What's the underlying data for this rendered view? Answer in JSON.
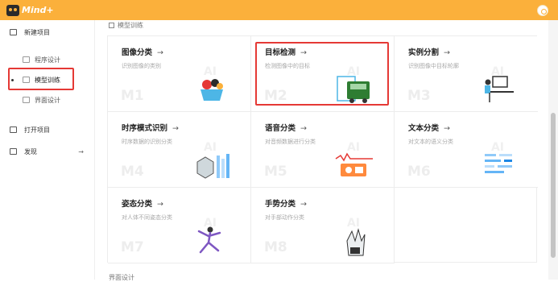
{
  "app": {
    "logo_text": "Mind+"
  },
  "sidebar": {
    "new_project": "新建项目",
    "program_design": "程序设计",
    "model_training": "模型训练",
    "ui_design": "界面设计",
    "open_project": "打开项目",
    "discover": "发现"
  },
  "main": {
    "section_title": "模型训练",
    "next_section": "界面设计",
    "cards": [
      {
        "title": "图像分类",
        "arrow": "→",
        "desc": "识别图像的类别",
        "code": "M1",
        "ai": "AI"
      },
      {
        "title": "目标检测",
        "arrow": "→",
        "desc": "检测图像中的目标",
        "code": "M2",
        "ai": "AI"
      },
      {
        "title": "实例分割",
        "arrow": "→",
        "desc": "识别图像中目标轮廓",
        "code": "M3",
        "ai": "AI"
      },
      {
        "title": "时序模式识别",
        "arrow": "→",
        "desc": "时序数据的识别分类",
        "code": "M4",
        "ai": "AI"
      },
      {
        "title": "语音分类",
        "arrow": "→",
        "desc": "对音频数据进行分类",
        "code": "M5",
        "ai": "AI"
      },
      {
        "title": "文本分类",
        "arrow": "→",
        "desc": "对文本的语义分类",
        "code": "M6",
        "ai": "AI"
      },
      {
        "title": "姿态分类",
        "arrow": "→",
        "desc": "对人体不同姿态分类",
        "code": "M7",
        "ai": "AI"
      },
      {
        "title": "手势分类",
        "arrow": "→",
        "desc": "对手部动作分类",
        "code": "M8",
        "ai": "AI"
      }
    ]
  },
  "colors": {
    "accent": "#fbb03b",
    "highlight": "#e53935"
  }
}
